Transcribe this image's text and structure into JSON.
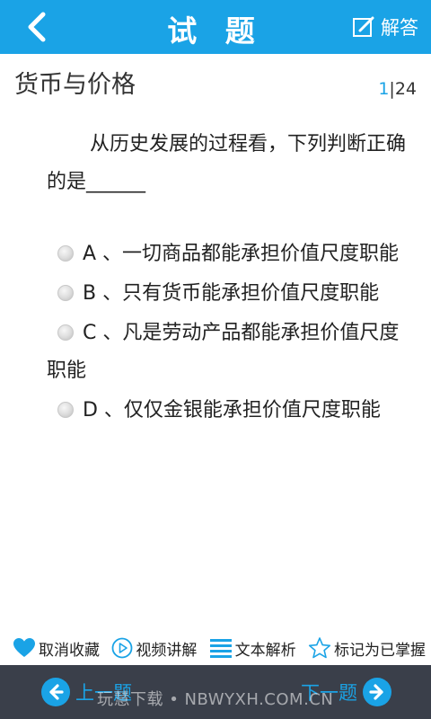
{
  "header": {
    "title": "试 题",
    "answer_label": "解答"
  },
  "chapter": {
    "title": "货币与价格",
    "current": "1",
    "separator": "|",
    "total": "24"
  },
  "question": {
    "text": "从历史发展的过程看，下列判断正确的是______"
  },
  "options": [
    {
      "label": "A 、一切商品都能承担价值尺度职能"
    },
    {
      "label": "B 、只有货币能承担价值尺度职能"
    },
    {
      "label": "C 、凡是劳动产品都能承担价值尺度职能"
    },
    {
      "label": "D 、仅仅金银能承担价值尺度职能"
    }
  ],
  "actions": {
    "cancel_favorite": "取消收藏",
    "video_explain": "视频讲解",
    "text_analysis": "文本解析",
    "mark_mastered": "标记为已掌握"
  },
  "footer": {
    "prev_label": "上一题",
    "next_label": "下一题",
    "watermark": "玩慧下载 • NBWYXH.COM.CN"
  },
  "colors": {
    "accent": "#1aa3e6",
    "footer_bg": "#3a3f4a"
  }
}
